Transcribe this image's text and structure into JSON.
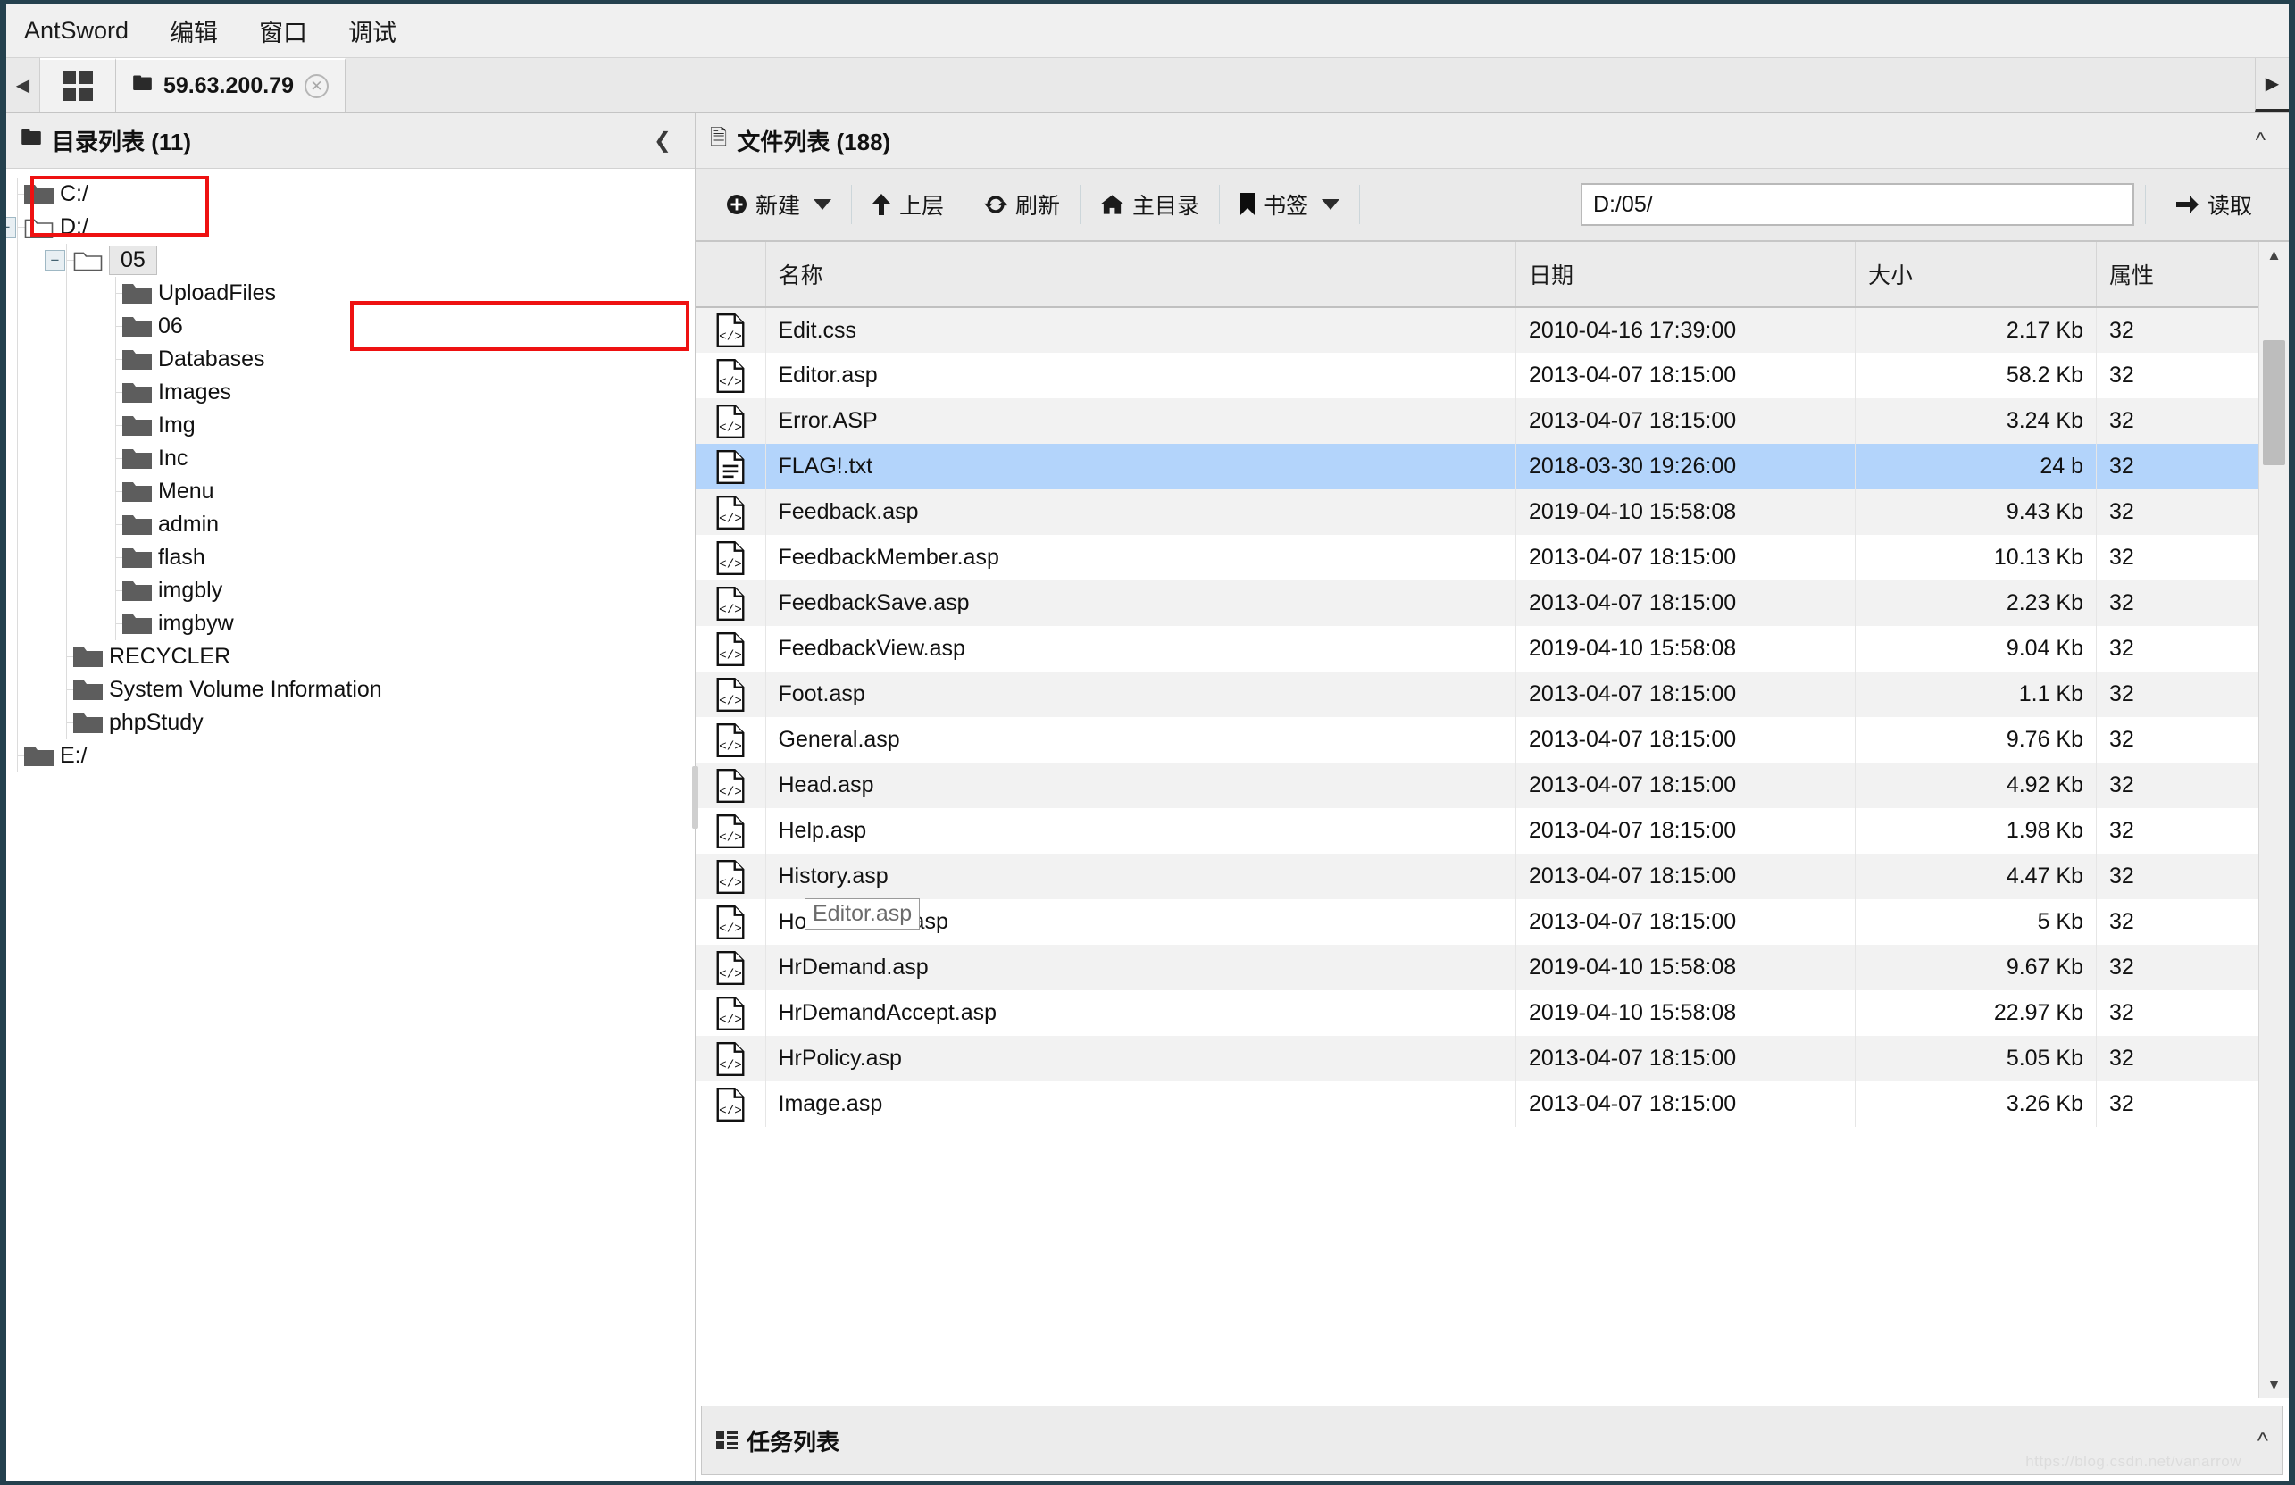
{
  "window": {
    "app_title": "AntSword",
    "menu": [
      "AntSword",
      "编辑",
      "窗口",
      "调试"
    ]
  },
  "tabstrip": {
    "nav_left_icon": "chevron-left-icon",
    "nav_right_icon": "chevron-right-icon",
    "grid_icon": "grid-icon",
    "tab": {
      "folder_icon": "folder-icon",
      "label": "59.63.200.79",
      "close_icon": "close-icon"
    }
  },
  "left_panel": {
    "header": {
      "icon": "folder-icon",
      "title": "目录列表 (11)",
      "collapse_icon": "chevron-left-icon"
    },
    "tree": [
      {
        "label": "C:/",
        "depth": 0,
        "toggler": "",
        "icon": "folder-closed",
        "selected": false
      },
      {
        "label": "D:/",
        "depth": 0,
        "toggler": "minus",
        "icon": "folder-open",
        "selected": false
      },
      {
        "label": "05",
        "depth": 1,
        "toggler": "minus",
        "icon": "folder-open",
        "selected": true
      },
      {
        "label": "UploadFiles",
        "depth": 2,
        "toggler": "",
        "icon": "folder-closed",
        "selected": false
      },
      {
        "label": "06",
        "depth": 2,
        "toggler": "",
        "icon": "folder-closed",
        "selected": false
      },
      {
        "label": "Databases",
        "depth": 2,
        "toggler": "",
        "icon": "folder-closed",
        "selected": false
      },
      {
        "label": "Images",
        "depth": 2,
        "toggler": "",
        "icon": "folder-closed",
        "selected": false
      },
      {
        "label": "Img",
        "depth": 2,
        "toggler": "",
        "icon": "folder-closed",
        "selected": false
      },
      {
        "label": "Inc",
        "depth": 2,
        "toggler": "",
        "icon": "folder-closed",
        "selected": false
      },
      {
        "label": "Menu",
        "depth": 2,
        "toggler": "",
        "icon": "folder-closed",
        "selected": false
      },
      {
        "label": "admin",
        "depth": 2,
        "toggler": "",
        "icon": "folder-closed",
        "selected": false
      },
      {
        "label": "flash",
        "depth": 2,
        "toggler": "",
        "icon": "folder-closed",
        "selected": false
      },
      {
        "label": "imgbly",
        "depth": 2,
        "toggler": "",
        "icon": "folder-closed",
        "selected": false
      },
      {
        "label": "imgbyw",
        "depth": 2,
        "toggler": "",
        "icon": "folder-closed",
        "selected": false
      },
      {
        "label": "RECYCLER",
        "depth": 1,
        "toggler": "",
        "icon": "folder-closed",
        "selected": false
      },
      {
        "label": "System Volume Information",
        "depth": 1,
        "toggler": "",
        "icon": "folder-closed",
        "selected": false
      },
      {
        "label": "phpStudy",
        "depth": 1,
        "toggler": "",
        "icon": "folder-closed",
        "selected": false
      },
      {
        "label": "E:/",
        "depth": 0,
        "toggler": "",
        "icon": "folder-closed",
        "selected": false
      }
    ],
    "highlight_note": "red annotation box around tree node 05"
  },
  "right_panel": {
    "header": {
      "icon": "file-icon",
      "title": "文件列表 (188)",
      "collapse_icon": "chevron-up-icon"
    },
    "toolbar": {
      "new_label": "新建",
      "new_icon": "plus-circle-icon",
      "up_label": "上层",
      "up_icon": "arrow-up-icon",
      "refresh_label": "刷新",
      "refresh_icon": "refresh-icon",
      "home_label": "主目录",
      "home_icon": "home-icon",
      "bookmark_label": "书签",
      "bookmark_icon": "bookmark-icon",
      "path_value": "D:/05/",
      "path_placeholder": "D:/05/",
      "read_label": "读取",
      "read_icon": "arrow-right-icon"
    },
    "columns": [
      "",
      "名称",
      "日期",
      "大小",
      "属性"
    ],
    "rows": [
      {
        "icon": "code-file-icon",
        "name": "Edit.css",
        "date": "2010-04-16 17:39:00",
        "size": "2.17 Kb",
        "attr": "32",
        "selected": false
      },
      {
        "icon": "code-file-icon",
        "name": "Editor.asp",
        "date": "2013-04-07 18:15:00",
        "size": "58.2 Kb",
        "attr": "32",
        "selected": false
      },
      {
        "icon": "code-file-icon",
        "name": "Error.ASP",
        "date": "2013-04-07 18:15:00",
        "size": "3.24 Kb",
        "attr": "32",
        "selected": false
      },
      {
        "icon": "text-file-icon",
        "name": "FLAG!.txt",
        "date": "2018-03-30 19:26:00",
        "size": "24 b",
        "attr": "32",
        "selected": true
      },
      {
        "icon": "code-file-icon",
        "name": "Feedback.asp",
        "date": "2019-04-10 15:58:08",
        "size": "9.43 Kb",
        "attr": "32",
        "selected": false
      },
      {
        "icon": "code-file-icon",
        "name": "FeedbackMember.asp",
        "date": "2013-04-07 18:15:00",
        "size": "10.13 Kb",
        "attr": "32",
        "selected": false
      },
      {
        "icon": "code-file-icon",
        "name": "FeedbackSave.asp",
        "date": "2013-04-07 18:15:00",
        "size": "2.23 Kb",
        "attr": "32",
        "selected": false
      },
      {
        "icon": "code-file-icon",
        "name": "FeedbackView.asp",
        "date": "2019-04-10 15:58:08",
        "size": "9.04 Kb",
        "attr": "32",
        "selected": false
      },
      {
        "icon": "code-file-icon",
        "name": "Foot.asp",
        "date": "2013-04-07 18:15:00",
        "size": "1.1 Kb",
        "attr": "32",
        "selected": false
      },
      {
        "icon": "code-file-icon",
        "name": "General.asp",
        "date": "2013-04-07 18:15:00",
        "size": "9.76 Kb",
        "attr": "32",
        "selected": false
      },
      {
        "icon": "code-file-icon",
        "name": "Head.asp",
        "date": "2013-04-07 18:15:00",
        "size": "4.92 Kb",
        "attr": "32",
        "selected": false
      },
      {
        "icon": "code-file-icon",
        "name": "Help.asp",
        "date": "2013-04-07 18:15:00",
        "size": "1.98 Kb",
        "attr": "32",
        "selected": false
      },
      {
        "icon": "code-file-icon",
        "name": "History.asp",
        "date": "2013-04-07 18:15:00",
        "size": "4.47 Kb",
        "attr": "32",
        "selected": false
      },
      {
        "icon": "code-file-icon",
        "name": "HomeMarket.asp",
        "date": "2013-04-07 18:15:00",
        "size": "5 Kb",
        "attr": "32",
        "selected": false
      },
      {
        "icon": "code-file-icon",
        "name": "HrDemand.asp",
        "date": "2019-04-10 15:58:08",
        "size": "9.67 Kb",
        "attr": "32",
        "selected": false
      },
      {
        "icon": "code-file-icon",
        "name": "HrDemandAccept.asp",
        "date": "2019-04-10 15:58:08",
        "size": "22.97 Kb",
        "attr": "32",
        "selected": false
      },
      {
        "icon": "code-file-icon",
        "name": "HrPolicy.asp",
        "date": "2013-04-07 18:15:00",
        "size": "5.05 Kb",
        "attr": "32",
        "selected": false
      },
      {
        "icon": "code-file-icon",
        "name": "Image.asp",
        "date": "2013-04-07 18:15:00",
        "size": "3.26 Kb",
        "attr": "32",
        "selected": false
      }
    ],
    "tooltip": {
      "text": "Editor.asp"
    },
    "highlight_note": "red annotation box around row FLAG!.txt"
  },
  "taskbar": {
    "icon": "list-icon",
    "title": "任务列表",
    "collapse_icon": "chevron-up-icon"
  },
  "watermark": {
    "text": "https://blog.csdn.net/vanarrow"
  },
  "colors": {
    "selection_blue": "#b3d4fb",
    "annotation_red": "#ee1111",
    "chrome_gray": "#eaeaea",
    "window_border": "#24414e"
  }
}
